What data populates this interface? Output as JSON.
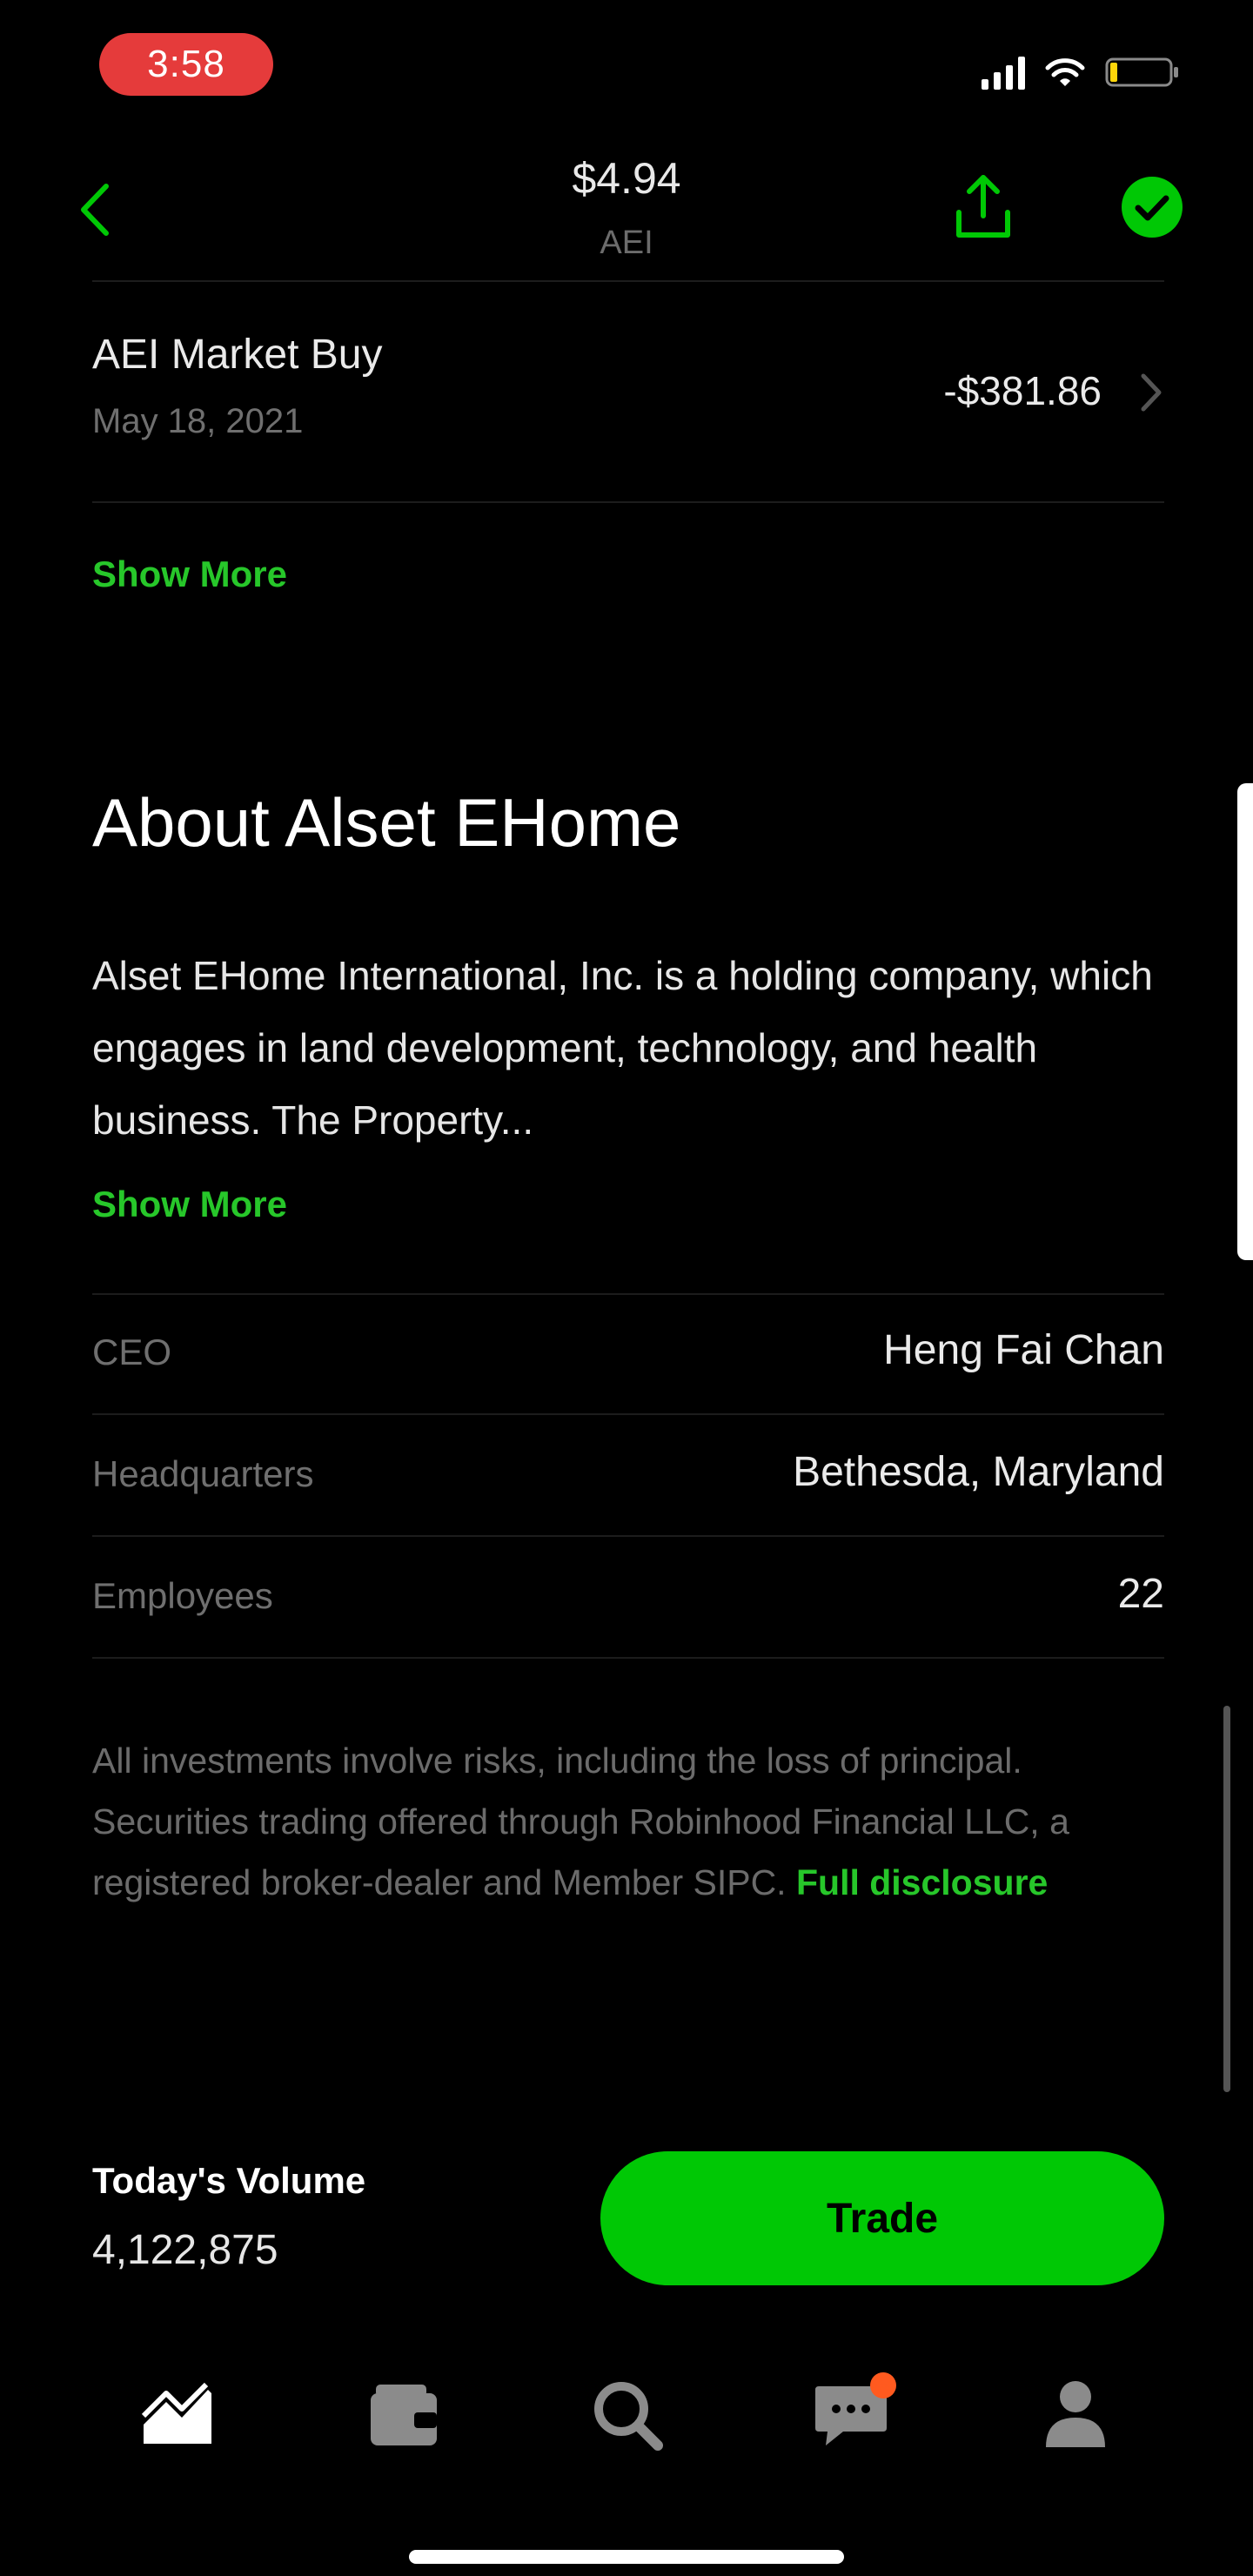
{
  "status_bar": {
    "time": "3:58"
  },
  "header": {
    "price": "$4.94",
    "symbol": "AEI",
    "accent_color": "#00c805",
    "icons": [
      "back-chevron-icon",
      "share-icon",
      "check-circle-icon"
    ]
  },
  "transaction": {
    "title": "AEI Market Buy",
    "date": "May 18, 2021",
    "amount": "-$381.86"
  },
  "history_show_more": "Show More",
  "about": {
    "title": "About Alset EHome",
    "description": "Alset EHome International, Inc. is a holding company, which engages in land development, technology, and health business. The Property...",
    "show_more": "Show More",
    "details": [
      {
        "label": "CEO",
        "value": "Heng Fai Chan"
      },
      {
        "label": "Headquarters",
        "value": "Bethesda, Maryland"
      },
      {
        "label": "Employees",
        "value": "22"
      }
    ]
  },
  "disclaimer": {
    "text": "All investments involve risks, including the loss of principal. Securities trading offered through Robinhood Financial LLC, a registered broker-dealer and Member SIPC.",
    "link": "Full disclosure"
  },
  "volume": {
    "label": "Today's Volume",
    "value": "4,122,875"
  },
  "trade_button": "Trade",
  "tab_bar": {
    "items": [
      "chart-icon",
      "wallet-icon",
      "search-icon",
      "messages-icon",
      "account-icon"
    ],
    "notification_color": "#ff5a1f"
  }
}
